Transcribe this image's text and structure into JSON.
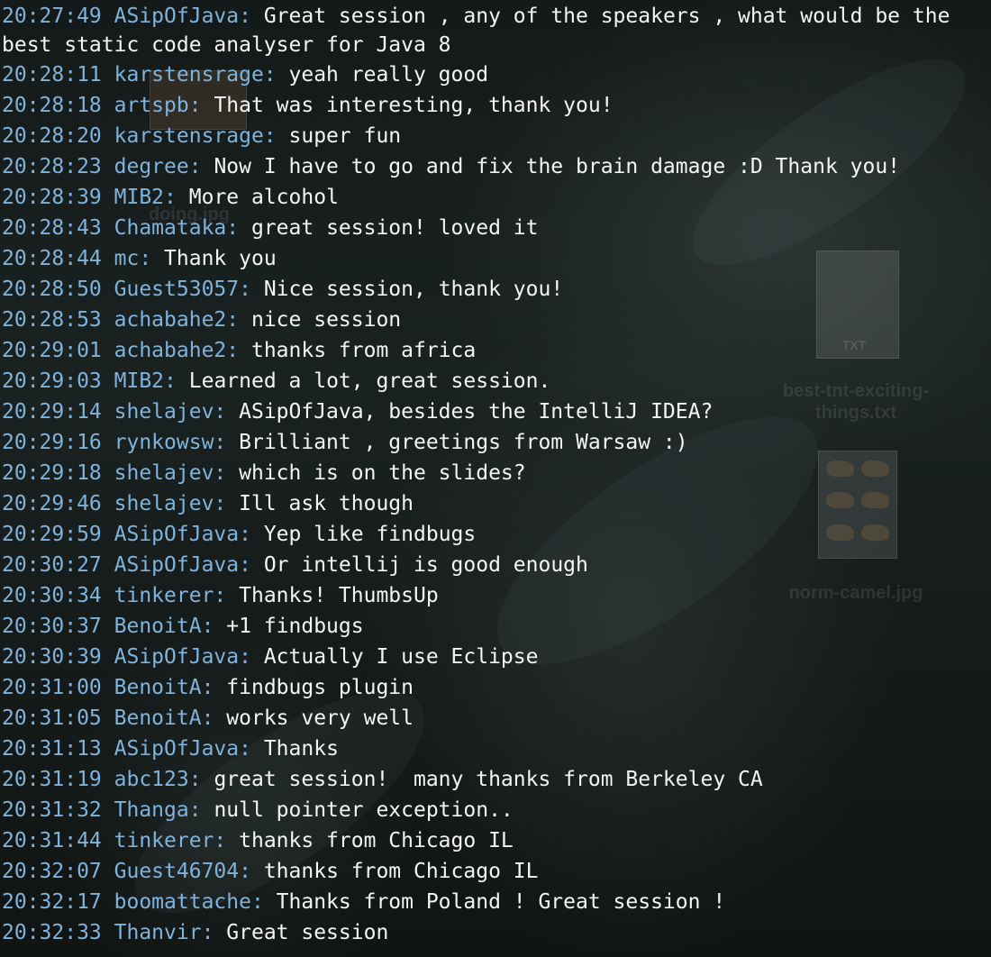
{
  "desktop": {
    "file1_type": "TXT",
    "file1_name": "best-tnt-exciting-things.txt",
    "file2_name": "norm-camel.jpg",
    "file3_name": "doing.jpg"
  },
  "chat": {
    "messages": [
      {
        "time": "20:27:49",
        "nick": "ASipOfJava:",
        "text": "Great session , any of the speakers , what would be the best static code analyser for Java 8"
      },
      {
        "time": "20:28:11",
        "nick": "karstensrage:",
        "text": "yeah really good"
      },
      {
        "time": "20:28:18",
        "nick": "artspb:",
        "text": "That was interesting, thank you!"
      },
      {
        "time": "20:28:20",
        "nick": "karstensrage:",
        "text": "super fun"
      },
      {
        "time": "20:28:23",
        "nick": "degree:",
        "text": "Now I have to go and fix the brain damage :D Thank you!"
      },
      {
        "time": "20:28:39",
        "nick": "MIB2:",
        "text": "More alcohol"
      },
      {
        "time": "20:28:43",
        "nick": "Chamataka:",
        "text": "great session! loved it"
      },
      {
        "time": "20:28:44",
        "nick": "mc:",
        "text": "Thank you"
      },
      {
        "time": "20:28:50",
        "nick": "Guest53057:",
        "text": "Nice session, thank you!"
      },
      {
        "time": "20:28:53",
        "nick": "achabahe2:",
        "text": "nice session"
      },
      {
        "time": "20:29:01",
        "nick": "achabahe2:",
        "text": "thanks from africa"
      },
      {
        "time": "20:29:03",
        "nick": "MIB2:",
        "text": "Learned a lot, great session."
      },
      {
        "time": "20:29:14",
        "nick": "shelajev:",
        "text": "ASipOfJava, besides the IntelliJ IDEA?"
      },
      {
        "time": "20:29:16",
        "nick": "rynkowsw:",
        "text": "Brilliant , greetings from Warsaw :)"
      },
      {
        "time": "20:29:18",
        "nick": "shelajev:",
        "text": "which is on the slides?"
      },
      {
        "time": "20:29:46",
        "nick": "shelajev:",
        "text": "Ill ask though"
      },
      {
        "time": "20:29:59",
        "nick": "ASipOfJava:",
        "text": "Yep like findbugs"
      },
      {
        "time": "20:30:27",
        "nick": "ASipOfJava:",
        "text": "Or intellij is good enough"
      },
      {
        "time": "20:30:34",
        "nick": "tinkerer:",
        "text": "Thanks! ThumbsUp"
      },
      {
        "time": "20:30:37",
        "nick": "BenoitA:",
        "text": "+1 findbugs"
      },
      {
        "time": "20:30:39",
        "nick": "ASipOfJava:",
        "text": "Actually I use Eclipse"
      },
      {
        "time": "20:31:00",
        "nick": "BenoitA:",
        "text": "findbugs plugin"
      },
      {
        "time": "20:31:05",
        "nick": "BenoitA:",
        "text": "works very well"
      },
      {
        "time": "20:31:13",
        "nick": "ASipOfJava:",
        "text": "Thanks"
      },
      {
        "time": "20:31:19",
        "nick": "abc123:",
        "text": "great session!  many thanks from Berkeley CA"
      },
      {
        "time": "20:31:32",
        "nick": "Thanga:",
        "text": "null pointer exception.."
      },
      {
        "time": "20:31:44",
        "nick": "tinkerer:",
        "text": "thanks from Chicago IL"
      },
      {
        "time": "20:32:07",
        "nick": "Guest46704:",
        "text": "thanks from Chicago IL"
      },
      {
        "time": "20:32:17",
        "nick": "boomattache:",
        "text": "Thanks from Poland ! Great session !"
      },
      {
        "time": "20:32:33",
        "nick": "Thanvir:",
        "text": "Great session"
      }
    ]
  }
}
